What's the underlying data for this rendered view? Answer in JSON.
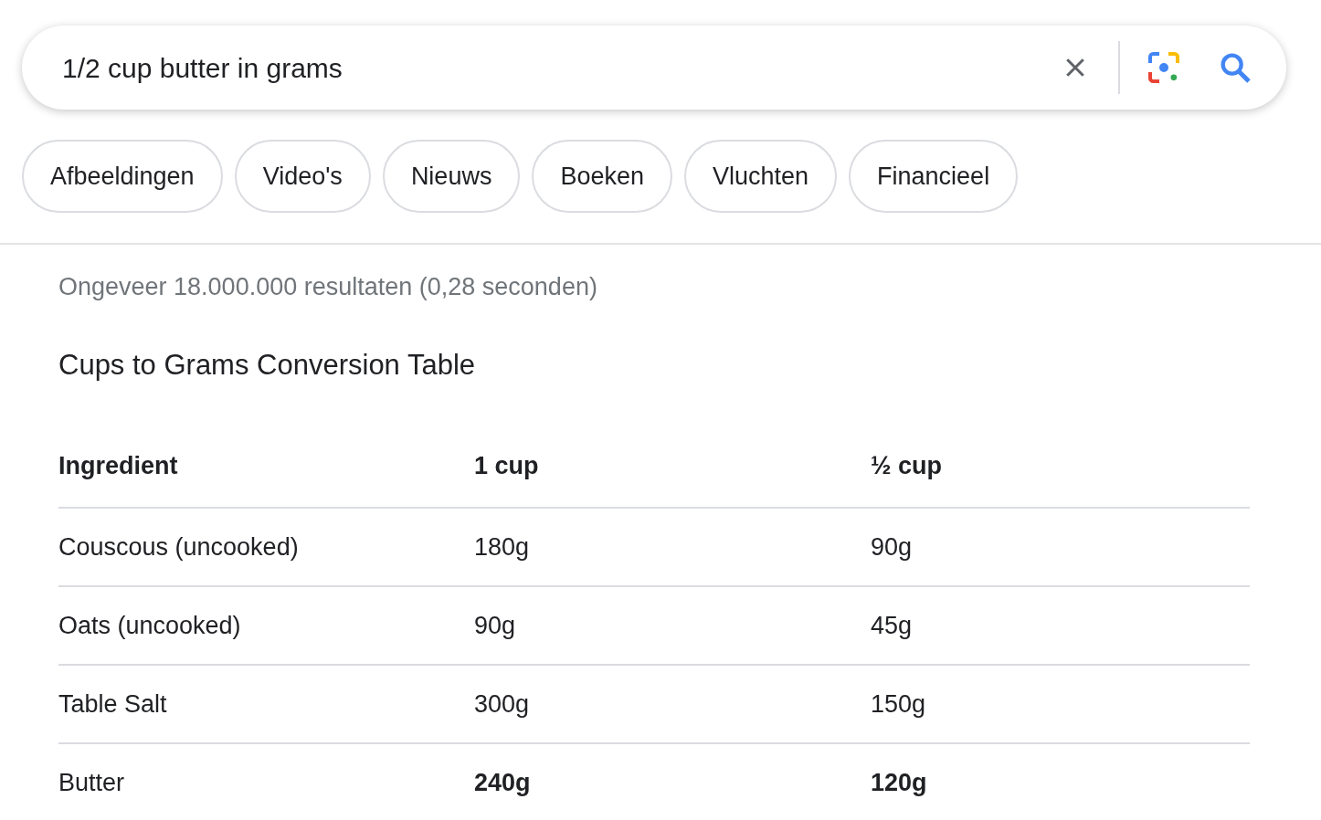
{
  "search": {
    "value": "1/2 cup butter in grams"
  },
  "chips": [
    {
      "label": "Afbeeldingen"
    },
    {
      "label": "Video's"
    },
    {
      "label": "Nieuws"
    },
    {
      "label": "Boeken"
    },
    {
      "label": "Vluchten"
    },
    {
      "label": "Financieel"
    }
  ],
  "result_stats": "Ongeveer 18.000.000 resultaten (0,28 seconden)",
  "table": {
    "title": "Cups to Grams Conversion Table",
    "columns": [
      "Ingredient",
      "1 cup",
      "½ cup"
    ],
    "rows": [
      {
        "cells": [
          {
            "text": "Couscous (uncooked)",
            "bold": false
          },
          {
            "text": "180g",
            "bold": false
          },
          {
            "text": "90g",
            "bold": false
          }
        ]
      },
      {
        "cells": [
          {
            "text": "Oats (uncooked)",
            "bold": false
          },
          {
            "text": "90g",
            "bold": false
          },
          {
            "text": "45g",
            "bold": false
          }
        ]
      },
      {
        "cells": [
          {
            "text": "Table Salt",
            "bold": false
          },
          {
            "text": "300g",
            "bold": false
          },
          {
            "text": "150g",
            "bold": false
          }
        ]
      },
      {
        "cells": [
          {
            "text": "Butter",
            "bold": false
          },
          {
            "text": "240g",
            "bold": true
          },
          {
            "text": "120g",
            "bold": true
          }
        ]
      }
    ]
  }
}
